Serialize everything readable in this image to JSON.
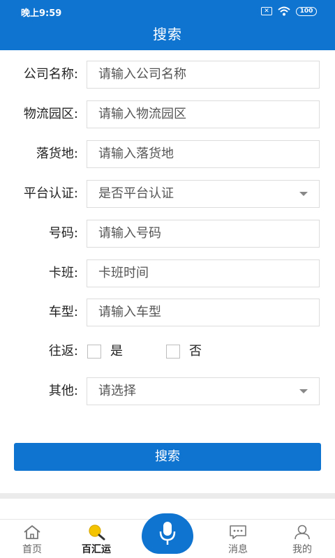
{
  "status_bar": {
    "time": "晚上9:59",
    "sim_label": "✕",
    "battery": "100"
  },
  "header": {
    "title": "搜索"
  },
  "form": {
    "company": {
      "label": "公司名称:",
      "placeholder": "请输入公司名称"
    },
    "park": {
      "label": "物流园区:",
      "placeholder": "请输入物流园区"
    },
    "destination": {
      "label": "落货地:",
      "placeholder": "请输入落货地"
    },
    "platform": {
      "label": "平台认证:",
      "selected": "是否平台认证"
    },
    "number": {
      "label": "号码:",
      "placeholder": "请输入号码"
    },
    "schedule": {
      "label": "卡班:",
      "placeholder": "卡班时间"
    },
    "vehicle": {
      "label": "车型:",
      "placeholder": "请输入车型"
    },
    "round_trip": {
      "label": "往返:",
      "yes_label": "是",
      "no_label": "否"
    },
    "other": {
      "label": "其他:",
      "selected": "请选择"
    }
  },
  "search_button_label": "搜索",
  "bottom_nav": {
    "home": {
      "label": "首页",
      "icon": "home-icon"
    },
    "baihuiyun": {
      "label": "百汇运",
      "icon": "magnifier-icon"
    },
    "mic": {
      "icon": "microphone-icon"
    },
    "messages": {
      "label": "消息",
      "icon": "chat-icon"
    },
    "mine": {
      "label": "我的",
      "icon": "user-icon"
    }
  },
  "colors": {
    "primary": "#0f73d0",
    "accent_yellow": "#f5c400"
  }
}
